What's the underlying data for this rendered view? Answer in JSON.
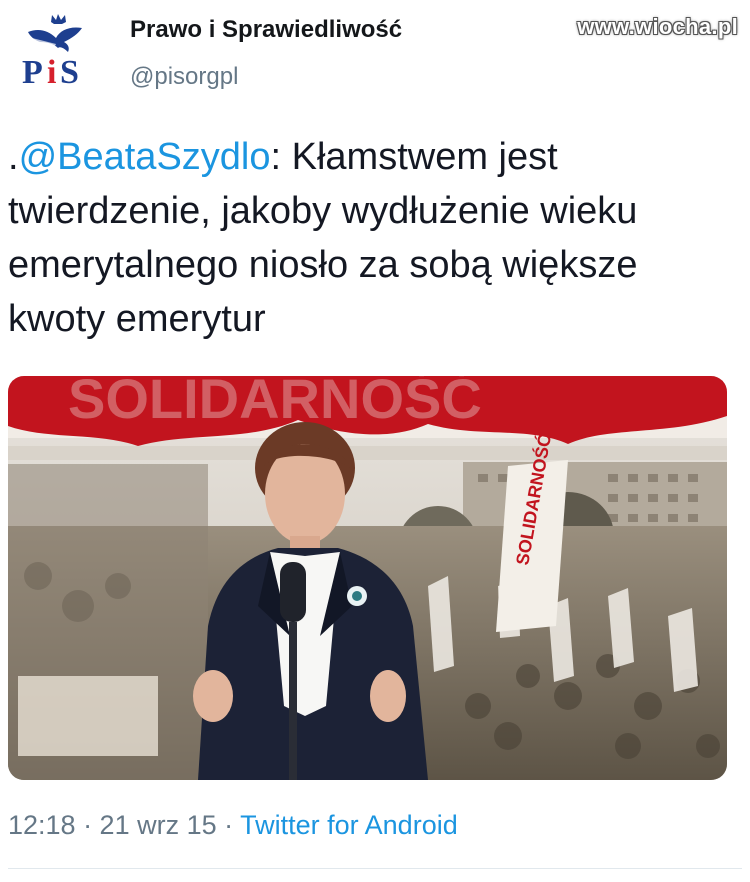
{
  "tweet": {
    "author": {
      "display_name": "Prawo i Sprawiedliwość",
      "handle": "@pisorgpl",
      "avatar_logo_text": "PiS",
      "avatar_icon": "eagle-crown-icon"
    },
    "text_prefix": ".",
    "mention": "@BeataSzydlo",
    "text_body": ": Kłamstwem jest twierdzenie, jakoby wydłużenie wieku emerytalnego niosło za sobą większe kwoty emerytur",
    "timestamp": "12:18 · 21 wrz 15 · ",
    "source": "Twitter for Android"
  },
  "watermark": "www.wiocha.pl",
  "media": {
    "banner_text": "SOLIDARNOŚĆ",
    "sign_text": "SOLIDARNOŚĆ"
  },
  "colors": {
    "link": "#1b95e0",
    "secondary_text": "#657786",
    "primary_text": "#141823",
    "logo_blue": "#1e3f8f",
    "logo_red": "#d6202c",
    "banner_red": "#c2141e"
  }
}
